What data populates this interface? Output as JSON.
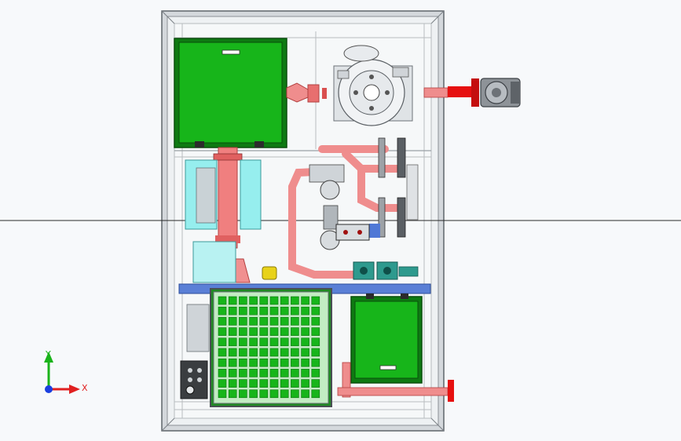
{
  "axes": {
    "x_label": "X",
    "y_label": "Y"
  },
  "colors": {
    "background": "#f7f9fb",
    "frame": "#c9cdd2",
    "frame_edge": "#6b7075",
    "green_panel": "#17b51a",
    "green_dark": "#0e7a12",
    "pipe_red": "#ef8d8d",
    "pipe_dark_red": "#d94f4f",
    "vivid_red": "#e61010",
    "cyan": "#96eeee",
    "blue_rail": "#5a7fd6",
    "teal": "#2e9a8e",
    "yellow": "#e8d21a",
    "axis_red": "#e02020",
    "axis_green": "#1ab31a",
    "axis_blue": "#1a3fe0"
  },
  "icons": {
    "pump": "circulation-pump-icon",
    "grille": "ventilation-grille-icon",
    "control": "control-panel-icon",
    "triad": "coordinate-triad-icon"
  }
}
